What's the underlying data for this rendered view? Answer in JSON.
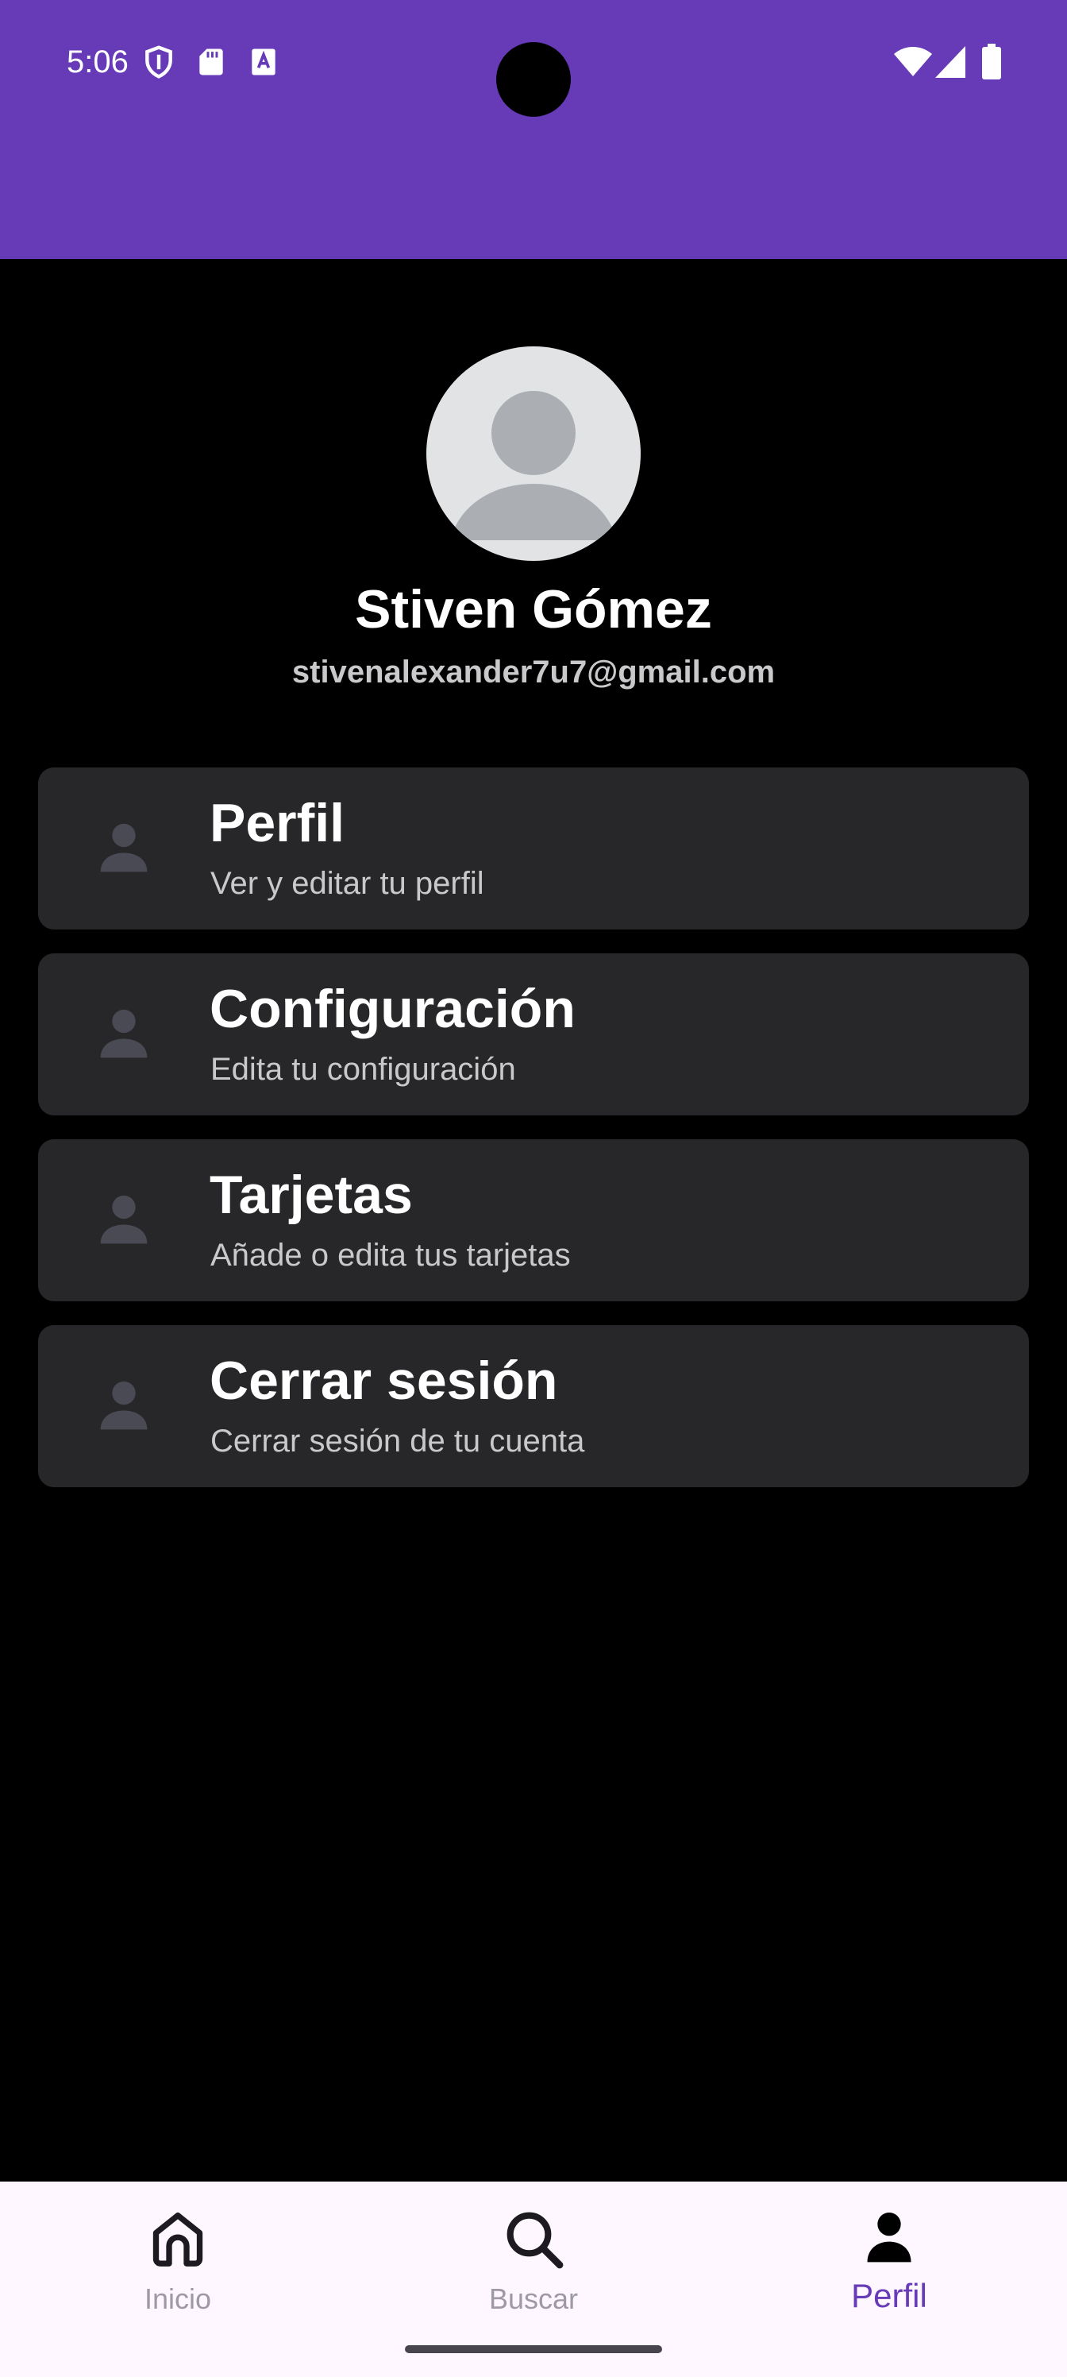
{
  "status_bar": {
    "time": "5:06",
    "icons": [
      "shield-icon",
      "sd-card-icon",
      "font-a-icon",
      "wifi-icon",
      "signal-icon",
      "battery-icon"
    ]
  },
  "profile": {
    "name": "Stiven Gómez",
    "email": "stivenalexander7u7@gmail.com",
    "avatar_icon": "person-icon"
  },
  "menu": [
    {
      "title": "Perfil",
      "subtitle": "Ver y editar tu perfil",
      "icon": "person-icon"
    },
    {
      "title": "Configuración",
      "subtitle": "Edita tu configuración",
      "icon": "person-icon"
    },
    {
      "title": "Tarjetas",
      "subtitle": "Añade o edita tus tarjetas",
      "icon": "person-icon"
    },
    {
      "title": "Cerrar sesión",
      "subtitle": "Cerrar sesión de tu cuenta",
      "icon": "person-icon"
    }
  ],
  "bottom_nav": {
    "items": [
      {
        "label": "Inicio",
        "icon": "home-icon"
      },
      {
        "label": "Buscar",
        "icon": "search-icon"
      },
      {
        "label": "Perfil",
        "icon": "person-icon"
      }
    ],
    "active": "Perfil"
  },
  "colors": {
    "primary": "#673AB7",
    "background": "#000000",
    "card": "#272729",
    "nav_background": "#FEF7FF",
    "nav_inactive": "#9E9AA3",
    "secondary_text": "#C9C9CC",
    "avatar_bg": "#E2E3E5",
    "avatar_fg": "#ABAEB3",
    "card_icon": "#4A4A55"
  }
}
